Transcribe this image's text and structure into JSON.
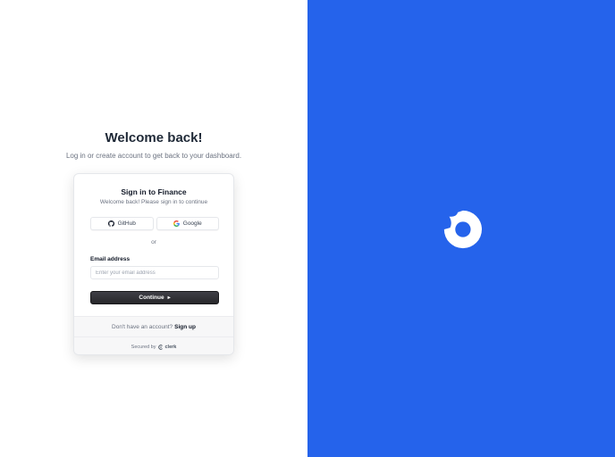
{
  "hero": {
    "title": "Welcome back!",
    "subtitle": "Log in or create account to get back to your dashboard."
  },
  "card": {
    "title": "Sign in to Finance",
    "subtitle": "Welcome back! Please sign in to continue",
    "social": {
      "github_label": "GitHub",
      "google_label": "Google"
    },
    "divider": "or",
    "email": {
      "label": "Email address",
      "placeholder": "Enter your email address",
      "value": ""
    },
    "continue_label": "Continue",
    "continue_arrow": "▸",
    "footer": {
      "no_account_text": "Don't have an account?",
      "signup_link": "Sign up",
      "secured_by": "Secured by",
      "brand": "clerk"
    }
  },
  "icons": {
    "github": "github-icon",
    "google": "google-icon",
    "clerk": "clerk-logo-icon",
    "app_logo": "finance-logo-icon"
  },
  "colors": {
    "brand_panel": "#2563eb",
    "button_dark": "#27272a",
    "logo": "#ffffff"
  }
}
